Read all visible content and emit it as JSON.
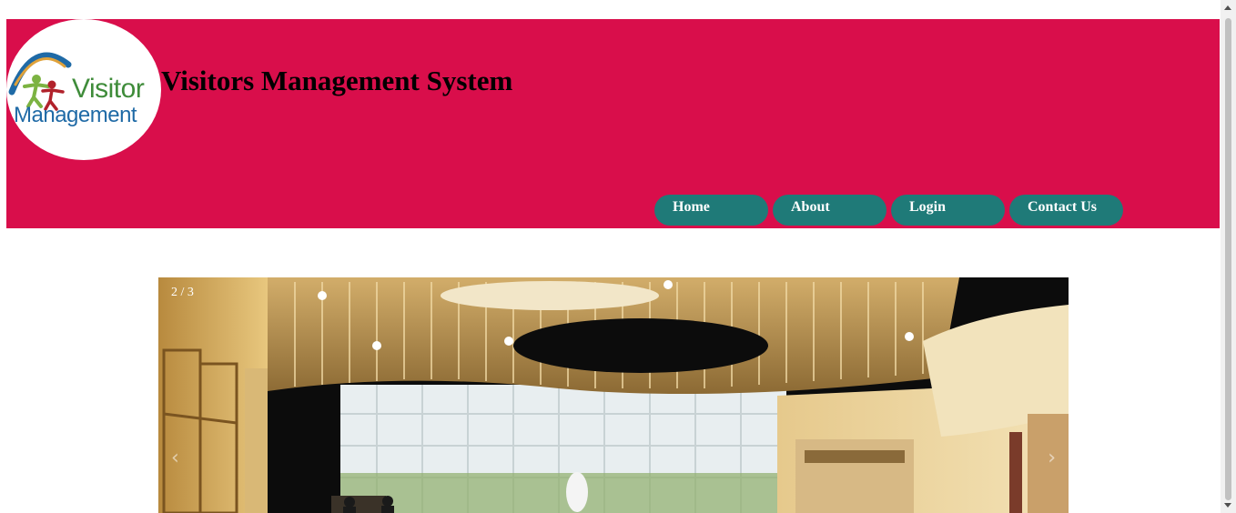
{
  "header": {
    "logo": {
      "line1": "Visitor",
      "line2": "Management"
    },
    "title": "Visitors Management System"
  },
  "nav": {
    "items": [
      "Home",
      "About",
      "Login",
      "Contact Us"
    ]
  },
  "slideshow": {
    "counter": "2 / 3",
    "prev_icon": "‹",
    "next_icon": "›",
    "image": "lobby-atrium-photo"
  },
  "colors": {
    "header_bg": "#d90e4b",
    "nav_button": "#1f7a78"
  }
}
